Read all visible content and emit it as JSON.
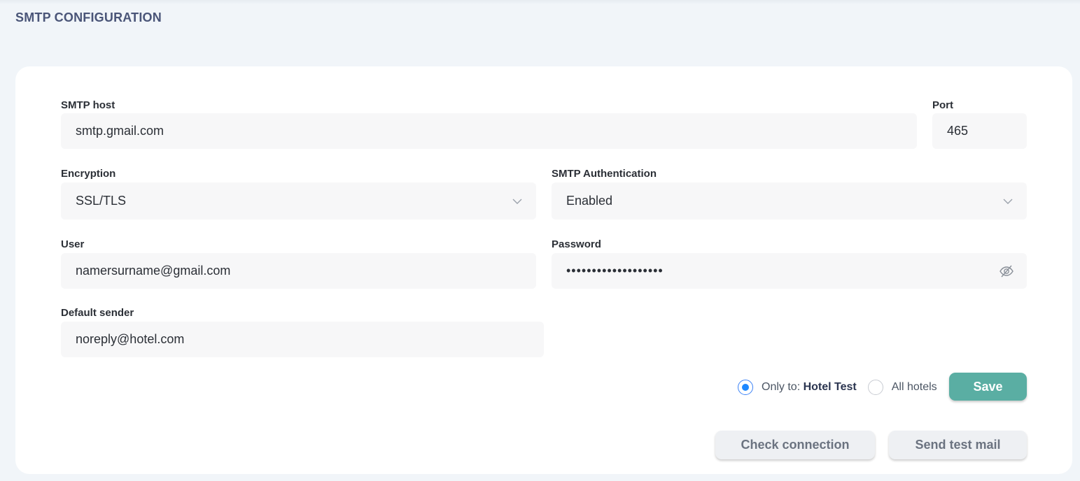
{
  "page": {
    "title": "SMTP CONFIGURATION"
  },
  "form": {
    "smtp_host": {
      "label": "SMTP host",
      "value": "smtp.gmail.com"
    },
    "port": {
      "label": "Port",
      "value": "465"
    },
    "encryption": {
      "label": "Encryption",
      "value": "SSL/TLS"
    },
    "smtp_auth": {
      "label": "SMTP Authentication",
      "value": "Enabled"
    },
    "user": {
      "label": "User",
      "value": "namersurname@gmail.com"
    },
    "password": {
      "label": "Password",
      "value": "•••••••••••••••••••"
    },
    "default_sender": {
      "label": "Default sender",
      "value": "noreply@hotel.com"
    }
  },
  "scope": {
    "only_to_prefix": "Only to:",
    "only_to_hotel": "Hotel Test",
    "all_hotels": "All hotels",
    "selected": "only_to"
  },
  "actions": {
    "save": "Save",
    "check_connection": "Check connection",
    "send_test_mail": "Send test mail"
  },
  "colors": {
    "accent": "#5aaea3",
    "radio_selected": "#1e88ff",
    "title": "#4a5578"
  },
  "icons": {
    "encryption_dropdown": "chevron-down-icon",
    "auth_dropdown": "chevron-down-icon",
    "password_toggle": "eye-off-icon"
  }
}
